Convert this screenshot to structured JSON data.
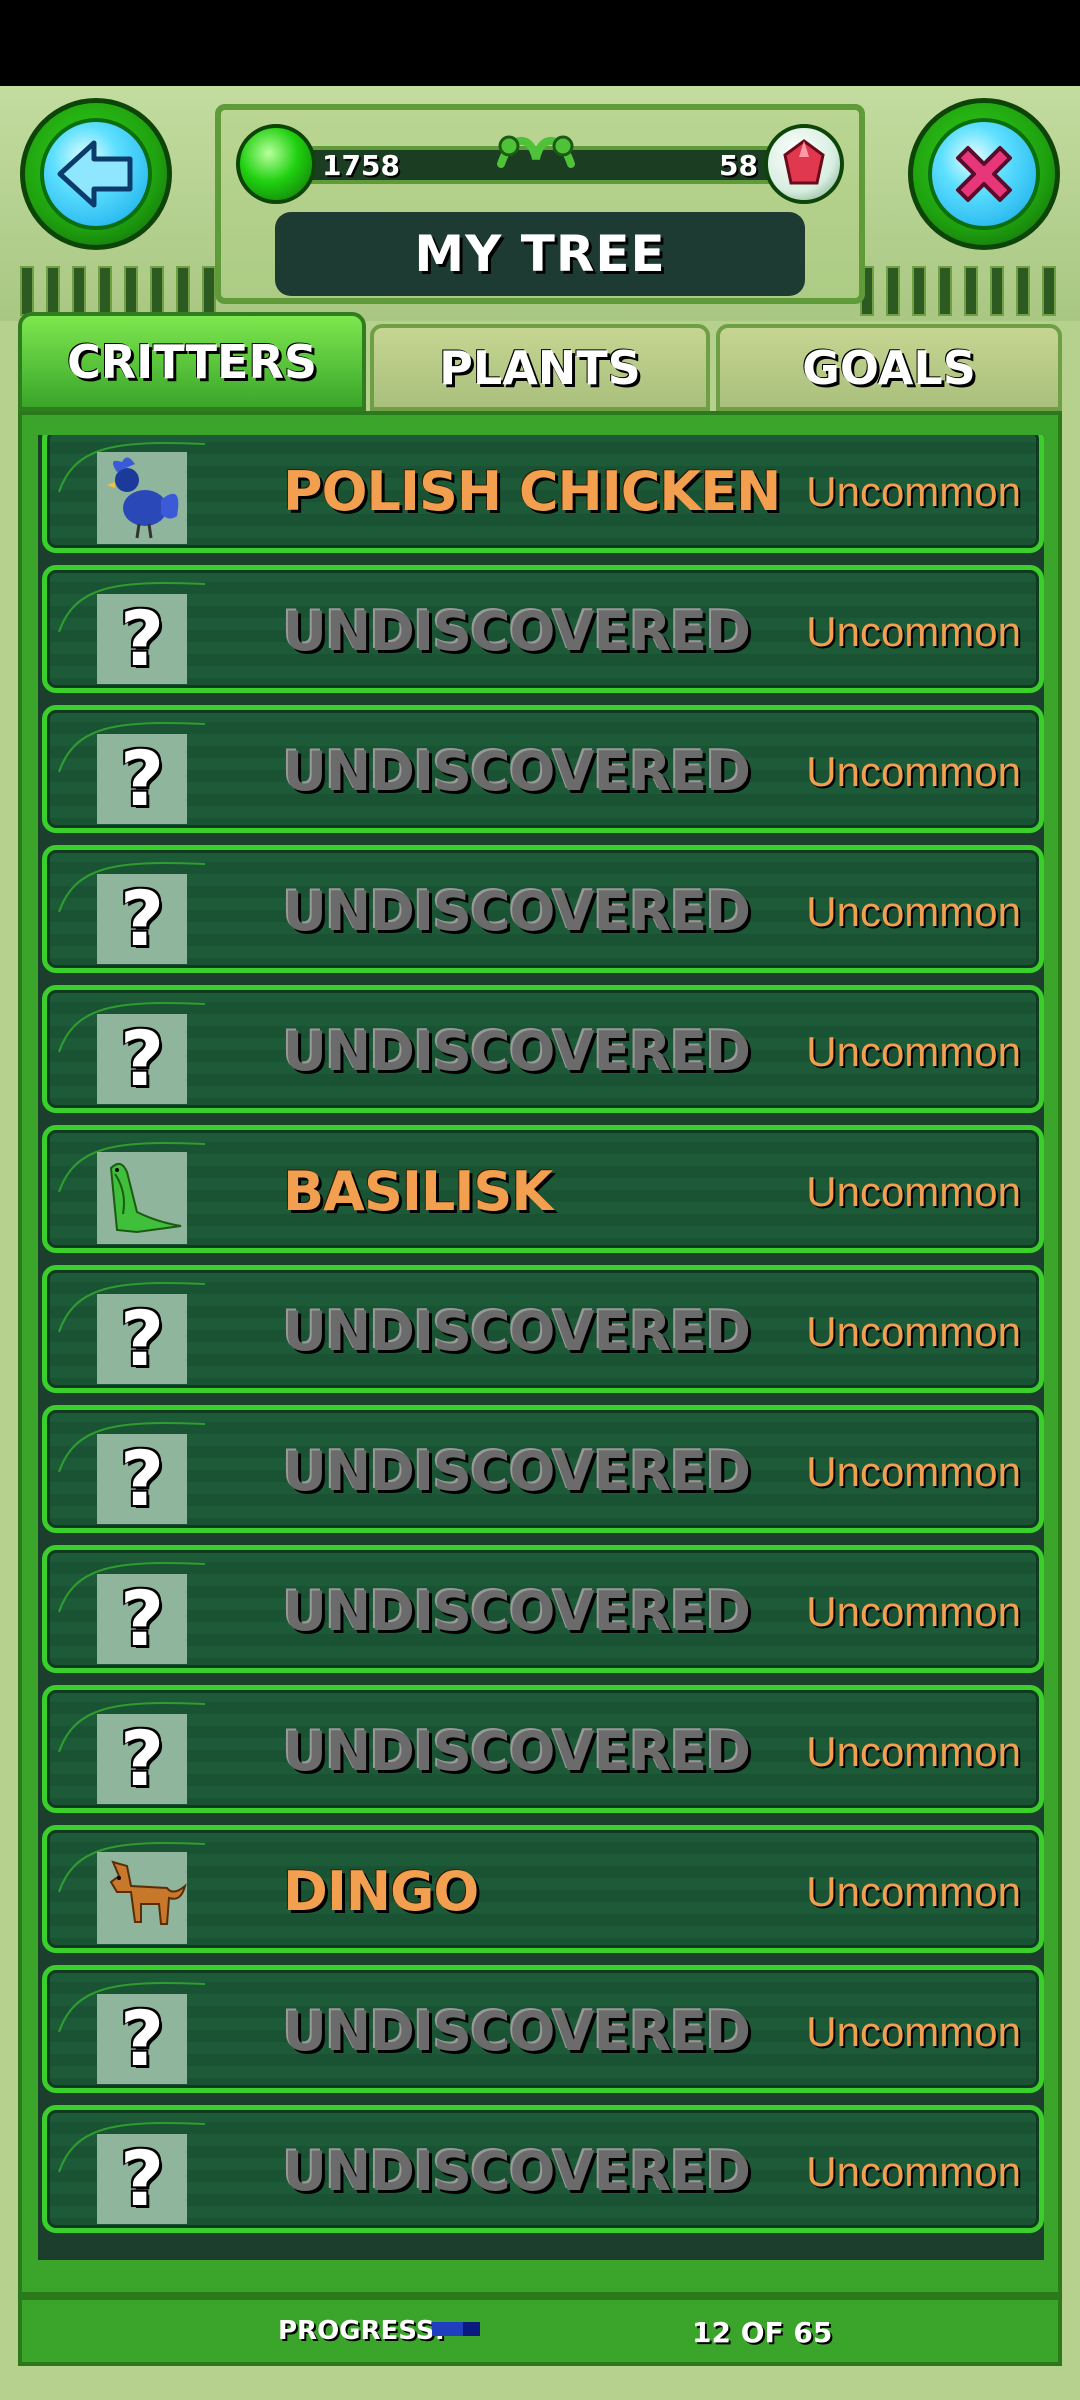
{
  "header": {
    "title": "MY TREE",
    "coins": "1758",
    "gems": "58"
  },
  "tabs": [
    {
      "label": "CRITTERS",
      "active": true
    },
    {
      "label": "PLANTS",
      "active": false
    },
    {
      "label": "GOALS",
      "active": false
    }
  ],
  "critters": [
    {
      "name": "POLISH CHICKEN",
      "rarity": "Uncommon",
      "discovered": true,
      "icon": "polish-chicken-icon"
    },
    {
      "name": "UNDISCOVERED",
      "rarity": "Uncommon",
      "discovered": false,
      "icon": "question-mark-icon"
    },
    {
      "name": "UNDISCOVERED",
      "rarity": "Uncommon",
      "discovered": false,
      "icon": "question-mark-icon"
    },
    {
      "name": "UNDISCOVERED",
      "rarity": "Uncommon",
      "discovered": false,
      "icon": "question-mark-icon"
    },
    {
      "name": "UNDISCOVERED",
      "rarity": "Uncommon",
      "discovered": false,
      "icon": "question-mark-icon"
    },
    {
      "name": "BASILISK",
      "rarity": "Uncommon",
      "discovered": true,
      "icon": "basilisk-icon"
    },
    {
      "name": "UNDISCOVERED",
      "rarity": "Uncommon",
      "discovered": false,
      "icon": "question-mark-icon"
    },
    {
      "name": "UNDISCOVERED",
      "rarity": "Uncommon",
      "discovered": false,
      "icon": "question-mark-icon"
    },
    {
      "name": "UNDISCOVERED",
      "rarity": "Uncommon",
      "discovered": false,
      "icon": "question-mark-icon"
    },
    {
      "name": "UNDISCOVERED",
      "rarity": "Uncommon",
      "discovered": false,
      "icon": "question-mark-icon"
    },
    {
      "name": "DINGO",
      "rarity": "Uncommon",
      "discovered": true,
      "icon": "dingo-icon"
    },
    {
      "name": "UNDISCOVERED",
      "rarity": "Uncommon",
      "discovered": false,
      "icon": "question-mark-icon"
    },
    {
      "name": "UNDISCOVERED",
      "rarity": "Uncommon",
      "discovered": false,
      "icon": "question-mark-icon"
    }
  ],
  "progress": {
    "label": "PROGRESS:",
    "count_text": "12 OF 65",
    "fraction": 0.1846
  },
  "colors": {
    "accent_green": "#3aa52a",
    "name_orange": "#f2a050",
    "undiscovered_gray": "#6b6b6b"
  }
}
